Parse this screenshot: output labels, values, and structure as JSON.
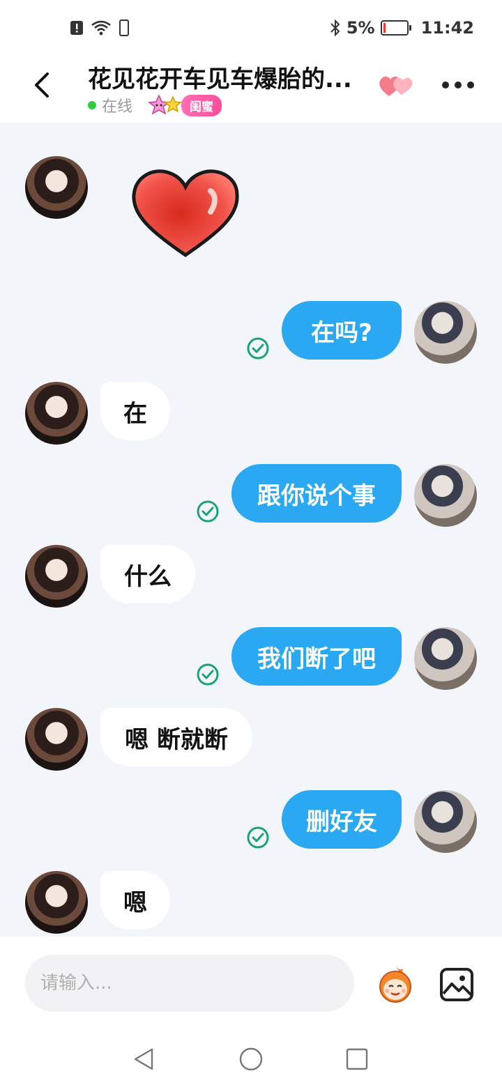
{
  "status_bar": {
    "battery_percent": "5%",
    "time": "11:42",
    "icons": [
      "alert-icon",
      "wifi-icon",
      "phone-icon",
      "bluetooth-icon",
      "battery-icon"
    ]
  },
  "header": {
    "title": "花见花开车见车爆胎的...",
    "status_text": "在线",
    "relation_badge": "闺蜜"
  },
  "messages": [
    {
      "side": "in",
      "type": "sticker",
      "sticker": "red-heart"
    },
    {
      "side": "out",
      "text": "在吗?",
      "read": true
    },
    {
      "side": "in",
      "text": "在"
    },
    {
      "side": "out",
      "text": "跟你说个事",
      "read": true
    },
    {
      "side": "in",
      "text": "什么"
    },
    {
      "side": "out",
      "text": "我们断了吧",
      "read": true
    },
    {
      "side": "in",
      "text": "嗯 断就断"
    },
    {
      "side": "out",
      "text": "删好友",
      "read": true
    },
    {
      "side": "in",
      "text": "嗯"
    }
  ],
  "input": {
    "placeholder": "请输入..."
  },
  "colors": {
    "outgoing_bubble": "#2aa9f2",
    "incoming_bubble": "#ffffff",
    "chat_background": "#f2f6fb",
    "read_check": "#1aa36f",
    "online_dot": "#2ecc40",
    "badge": "#ff4d9a"
  }
}
